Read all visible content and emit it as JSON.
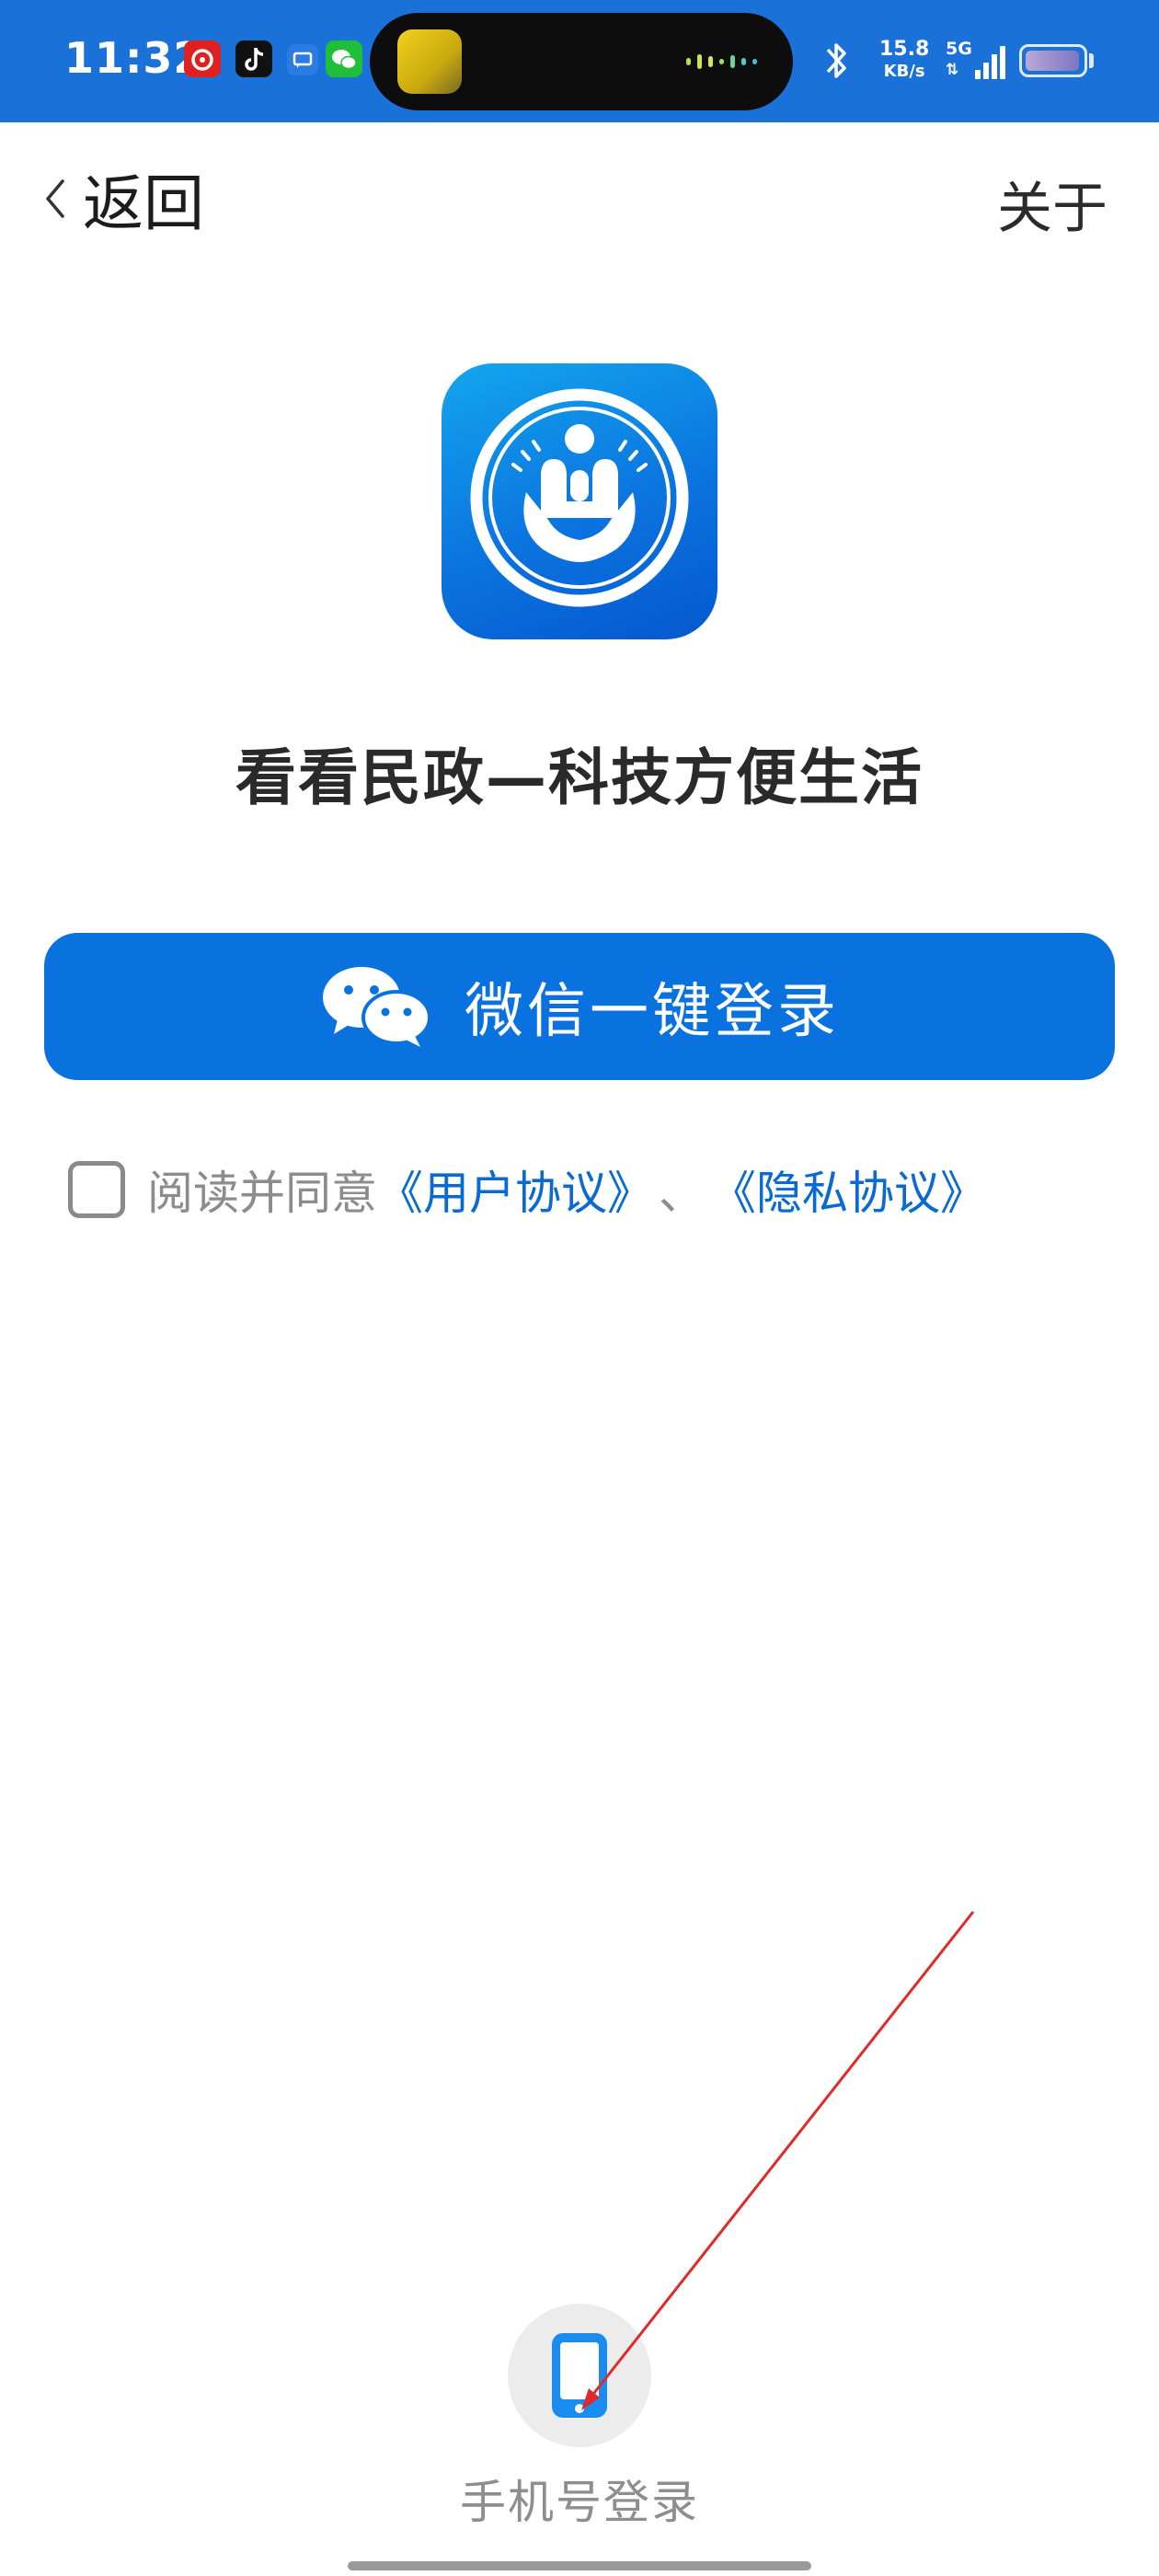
{
  "status_bar": {
    "time": "11:32",
    "net_speed_value": "15.8",
    "net_speed_unit": "KB/s",
    "network_type": "5G",
    "background_color": "#1a72d9"
  },
  "nav": {
    "back_label": "返回",
    "about_label": "关于"
  },
  "app": {
    "tagline": "看看民政—科技方便生活",
    "logo_icon": "civil-affairs-logo-icon"
  },
  "wechat_login": {
    "label": "微信一键登录",
    "icon": "wechat-icon",
    "color": "#0a72de"
  },
  "agreement": {
    "prefix": "阅读并同意",
    "user_agreement": "《用户协议》",
    "separator": "、",
    "privacy_agreement": "《隐私协议》",
    "checked": false,
    "link_color": "#0a6ad4"
  },
  "phone_login": {
    "label": "手机号登录",
    "icon": "mobile-phone-icon",
    "icon_color": "#1a8cf0"
  },
  "annotation": {
    "arrow_color": "#e02a2a"
  }
}
